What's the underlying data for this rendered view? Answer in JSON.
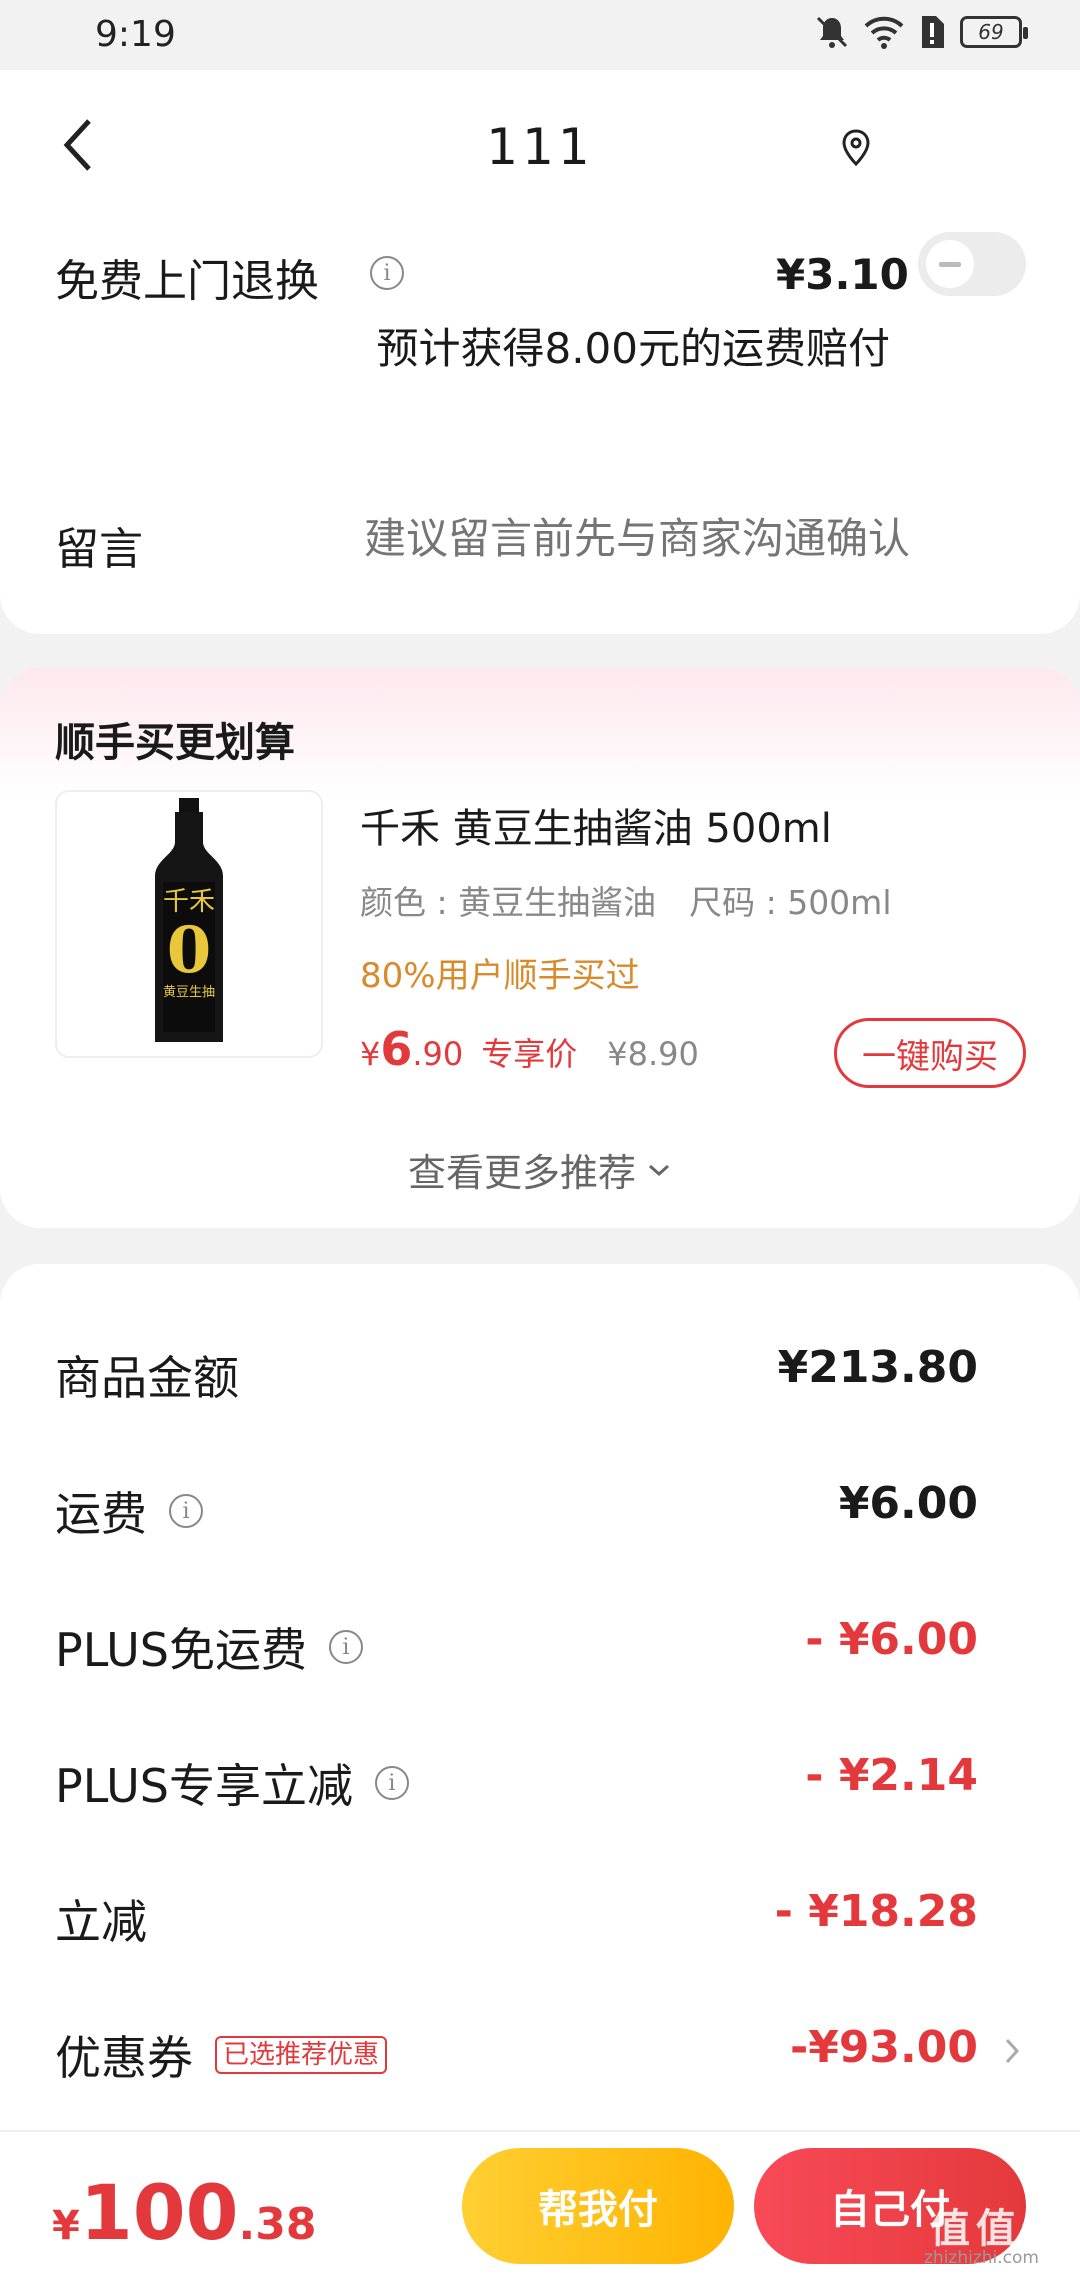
{
  "status_bar": {
    "time": "9:19",
    "battery": "69"
  },
  "header": {
    "title": "111"
  },
  "return_service": {
    "label": "免费上门退换",
    "price": "¥3.10",
    "note": "预计获得8.00元的运费赔付",
    "enabled": false
  },
  "message": {
    "label": "留言",
    "placeholder": "建议留言前先与商家沟通确认"
  },
  "recommend": {
    "section_title": "顺手买更划算",
    "product": {
      "name": "千禾 黄豆生抽酱油 500ml",
      "spec": "颜色 : 黄豆生抽酱油　尺码 : 500ml",
      "hint": "80%用户顺手买过",
      "price_symbol": "¥",
      "price_int": "6",
      "price_dec": ".90",
      "price_tag": "专享价",
      "original_price": "¥8.90",
      "buy_label": "一键购买",
      "bottle_brand": "千禾",
      "bottle_big": "0",
      "bottle_sub": "黄豆生抽"
    },
    "more_label": "查看更多推荐"
  },
  "summary": {
    "rows": [
      {
        "label": "商品金额",
        "value": "¥213.80",
        "info": false,
        "red": false
      },
      {
        "label": "运费",
        "value": "¥6.00",
        "info": true,
        "red": false
      },
      {
        "label": "PLUS免运费",
        "value": "- ¥6.00",
        "info": true,
        "red": true
      },
      {
        "label": "PLUS专享立减",
        "value": "- ¥2.14",
        "info": true,
        "red": true
      },
      {
        "label": "立减",
        "value": "- ¥18.28",
        "info": false,
        "red": true
      }
    ],
    "coupon": {
      "label": "优惠券",
      "tag": "已选推荐优惠",
      "value": "-¥93.00"
    }
  },
  "bottom_bar": {
    "currency": "¥",
    "total_int": "100",
    "total_dec": ".38",
    "help_pay": "帮我付",
    "self_pay": "自己付",
    "watermark": "值 值 值",
    "watermark_sub": "zhizhizhi.com"
  },
  "colors": {
    "accent_red": "#e4393c",
    "accent_yellow": "#ffb300",
    "orange_hint": "#d98a2b"
  }
}
